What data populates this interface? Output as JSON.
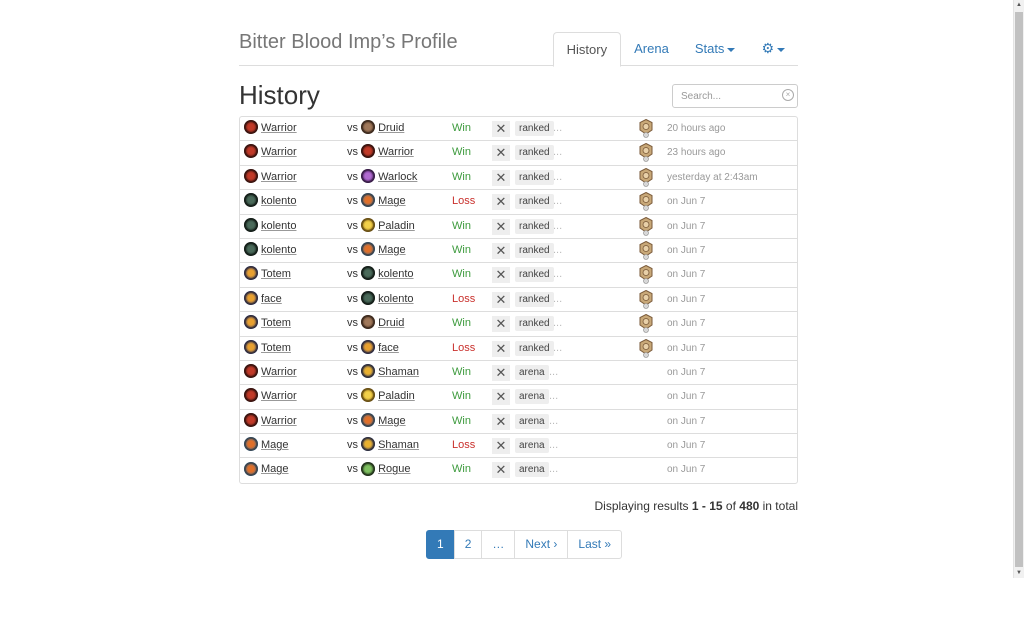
{
  "header": {
    "title": "Bitter Blood Imp’s Profile",
    "tabs": [
      {
        "label": "History",
        "active": true
      },
      {
        "label": "Arena",
        "active": false
      },
      {
        "label": "Stats",
        "active": false,
        "dropdown": true
      }
    ],
    "settings_icon": "gear-icon"
  },
  "main": {
    "heading": "History",
    "search_placeholder": "Search...",
    "vs_label": "vs",
    "dots": "...",
    "matches": [
      {
        "hero": "Warrior",
        "hero_class": "warrior",
        "opponent": "Druid",
        "opp_class": "druid",
        "result": "Win",
        "mode": "ranked",
        "rank": true,
        "time": "20 hours ago"
      },
      {
        "hero": "Warrior",
        "hero_class": "warrior",
        "opponent": "Warrior",
        "opp_class": "warrior",
        "result": "Win",
        "mode": "ranked",
        "rank": true,
        "time": "23 hours ago"
      },
      {
        "hero": "Warrior",
        "hero_class": "warrior",
        "opponent": "Warlock",
        "opp_class": "warlock",
        "result": "Win",
        "mode": "ranked",
        "rank": true,
        "time": "yesterday at 2:43am"
      },
      {
        "hero": "kolento",
        "hero_class": "kolento",
        "opponent": "Mage",
        "opp_class": "mage",
        "result": "Loss",
        "mode": "ranked",
        "rank": true,
        "time": "on Jun 7"
      },
      {
        "hero": "kolento",
        "hero_class": "kolento",
        "opponent": "Paladin",
        "opp_class": "paladin",
        "result": "Win",
        "mode": "ranked",
        "rank": true,
        "time": "on Jun 7"
      },
      {
        "hero": "kolento",
        "hero_class": "kolento",
        "opponent": "Mage",
        "opp_class": "mage",
        "result": "Win",
        "mode": "ranked",
        "rank": true,
        "time": "on Jun 7"
      },
      {
        "hero": "Totem",
        "hero_class": "totem",
        "opponent": "kolento",
        "opp_class": "kolento",
        "result": "Win",
        "mode": "ranked",
        "rank": true,
        "time": "on Jun 7"
      },
      {
        "hero": "face",
        "hero_class": "face",
        "opponent": "kolento",
        "opp_class": "kolento",
        "result": "Loss",
        "mode": "ranked",
        "rank": true,
        "time": "on Jun 7"
      },
      {
        "hero": "Totem",
        "hero_class": "totem",
        "opponent": "Druid",
        "opp_class": "druid",
        "result": "Win",
        "mode": "ranked",
        "rank": true,
        "time": "on Jun 7"
      },
      {
        "hero": "Totem",
        "hero_class": "totem",
        "opponent": "face",
        "opp_class": "face",
        "result": "Loss",
        "mode": "ranked",
        "rank": true,
        "time": "on Jun 7"
      },
      {
        "hero": "Warrior",
        "hero_class": "warrior",
        "opponent": "Shaman",
        "opp_class": "shaman",
        "result": "Win",
        "mode": "arena",
        "rank": false,
        "time": "on Jun 7"
      },
      {
        "hero": "Warrior",
        "hero_class": "warrior",
        "opponent": "Paladin",
        "opp_class": "paladin",
        "result": "Win",
        "mode": "arena",
        "rank": false,
        "time": "on Jun 7"
      },
      {
        "hero": "Warrior",
        "hero_class": "warrior",
        "opponent": "Mage",
        "opp_class": "mage",
        "result": "Win",
        "mode": "arena",
        "rank": false,
        "time": "on Jun 7"
      },
      {
        "hero": "Mage",
        "hero_class": "mage",
        "opponent": "Shaman",
        "opp_class": "shaman",
        "result": "Loss",
        "mode": "arena",
        "rank": false,
        "time": "on Jun 7"
      },
      {
        "hero": "Mage",
        "hero_class": "mage",
        "opponent": "Rogue",
        "opp_class": "rogue",
        "result": "Win",
        "mode": "arena",
        "rank": false,
        "time": "on Jun 7"
      }
    ]
  },
  "footer": {
    "status_prefix": "Displaying results ",
    "range": "1 - 15",
    "of_label": " of ",
    "total": "480",
    "suffix": " in total"
  },
  "pagination": [
    {
      "label": "1",
      "active": true
    },
    {
      "label": "2",
      "active": false
    },
    {
      "label": "…",
      "active": false
    },
    {
      "label": "Next ›",
      "active": false
    },
    {
      "label": "Last »",
      "active": false
    }
  ],
  "colors": {
    "link": "#337ab7",
    "win": "#3c9a3c",
    "loss": "#c9302c"
  }
}
